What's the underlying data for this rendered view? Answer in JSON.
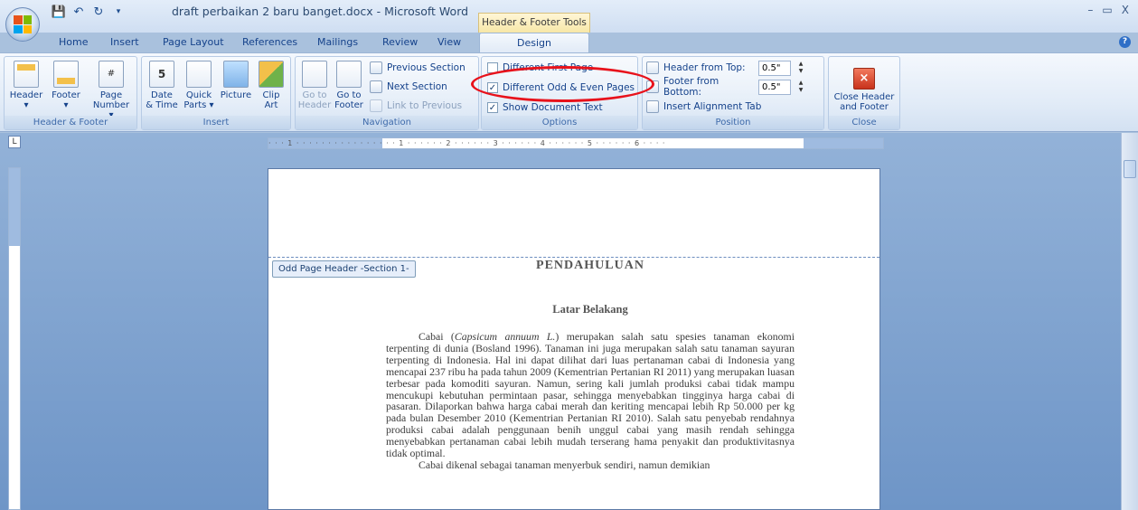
{
  "window": {
    "title": "draft perbaikan 2 baru banget.docx - Microsoft Word",
    "contextual_tab_group": "Header & Footer Tools",
    "controls": [
      "–",
      "▭",
      "X"
    ]
  },
  "quick_access": [
    "save-icon",
    "undo-icon",
    "redo-icon"
  ],
  "tabs": [
    "Home",
    "Insert",
    "Page Layout",
    "References",
    "Mailings",
    "Review",
    "View",
    "Design"
  ],
  "active_tab": "Design",
  "ribbon": {
    "header_footer": {
      "label": "Header & Footer",
      "header": "Header",
      "footer": "Footer",
      "page_number_1": "Page",
      "page_number_2": "Number ▾"
    },
    "insert": {
      "label": "Insert",
      "date_1": "Date",
      "date_2": "& Time",
      "quick_1": "Quick",
      "quick_2": "Parts ▾",
      "picture": "Picture",
      "clip_1": "Clip",
      "clip_2": "Art"
    },
    "navigation": {
      "label": "Navigation",
      "goto_header_1": "Go to",
      "goto_header_2": "Header",
      "goto_footer_1": "Go to",
      "goto_footer_2": "Footer",
      "previous_section": "Previous Section",
      "next_section": "Next Section",
      "link_to_previous": "Link to Previous"
    },
    "options": {
      "label": "Options",
      "different_first_page": "Different First Page",
      "different_odd_even": "Different Odd & Even Pages",
      "show_document_text": "Show Document Text",
      "different_first_page_checked": false,
      "different_odd_even_checked": true,
      "show_document_text_checked": true
    },
    "position": {
      "label": "Position",
      "header_from_top": "Header from Top:",
      "header_from_top_value": "0.5\"",
      "footer_from_bottom": "Footer from Bottom:",
      "footer_from_bottom_value": "0.5\"",
      "insert_alignment_tab": "Insert Alignment Tab"
    },
    "close": {
      "label": "Close",
      "close_1": "Close Header",
      "close_2": "and Footer"
    }
  },
  "ruler": {
    "corner": "L",
    "ticks": "· · · 1 · · · · · · · · · · · · · · · · 1 · · · · · · 2 · · · · · · 3 · · · · · · 4 · · · · · · 5 · · · · · · 6 · · · ·"
  },
  "document": {
    "header_tag": "Odd Page Header -Section 1-",
    "heading": "PENDAHULUAN",
    "subheading": "Latar Belakang",
    "paragraph_1_pre": "Cabai (",
    "paragraph_1_italic": "Capsicum annuum L.",
    "paragraph_1_post": ") merupakan salah satu spesies tanaman ekonomi terpenting di dunia (Bosland 1996). Tanaman ini juga merupakan salah satu tanaman sayuran terpenting di Indonesia. Hal ini dapat dilihat dari luas pertanaman cabai di Indonesia yang mencapai 237 ribu ha pada tahun 2009 (Kementrian Pertanian RI 2011) yang merupakan luasan terbesar pada komoditi sayuran. Namun, sering kali jumlah produksi cabai tidak mampu mencukupi kebutuhan permintaan pasar, sehingga menyebabkan tingginya harga cabai di pasaran. Dilaporkan bahwa harga cabai merah dan keriting mencapai lebih Rp 50.000 per kg pada bulan Desember 2010 (Kementrian Pertanian RI 2010). Salah satu penyebab rendahnya produksi cabai adalah penggunaan benih unggul cabai yang masih rendah sehingga menyebabkan pertanaman cabai lebih mudah terserang hama penyakit dan produktivitasnya tidak optimal.",
    "paragraph_2": "Cabai dikenal sebagai tanaman menyerbuk sendiri, namun demikian"
  },
  "colors": {
    "annotation_ellipse": "#e8121b",
    "ribbon_text": "#15428b"
  }
}
